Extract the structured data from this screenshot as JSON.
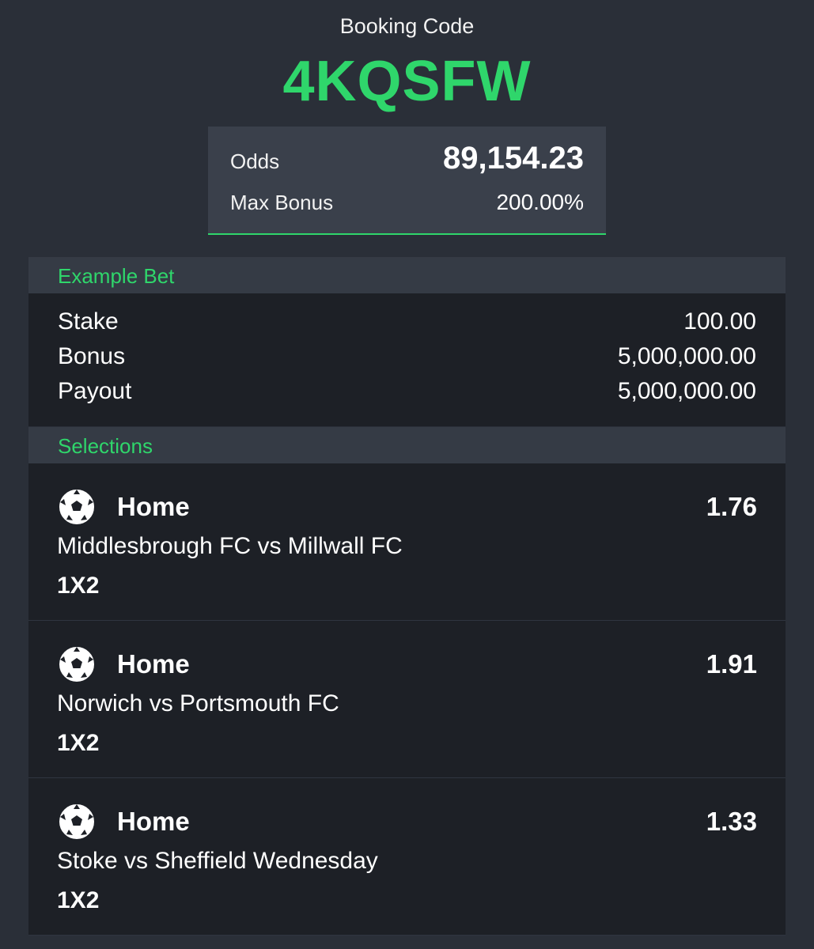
{
  "booking": {
    "label": "Booking Code",
    "code": "4KQSFW"
  },
  "summary": {
    "odds_label": "Odds",
    "odds_value": "89,154.23",
    "bonus_label": "Max Bonus",
    "bonus_value": "200.00%"
  },
  "example_bet": {
    "header": "Example Bet",
    "rows": [
      {
        "label": "Stake",
        "value": "100.00"
      },
      {
        "label": "Bonus",
        "value": "5,000,000.00"
      },
      {
        "label": "Payout",
        "value": "5,000,000.00"
      }
    ]
  },
  "selections": {
    "header": "Selections",
    "items": [
      {
        "pick": "Home",
        "odds": "1.76",
        "match": "Middlesbrough FC vs Millwall FC",
        "market": "1X2",
        "icon": "soccer-ball-icon"
      },
      {
        "pick": "Home",
        "odds": "1.91",
        "match": "Norwich vs Portsmouth FC",
        "market": "1X2",
        "icon": "soccer-ball-icon"
      },
      {
        "pick": "Home",
        "odds": "1.33",
        "match": "Stoke vs Sheffield Wednesday",
        "market": "1X2",
        "icon": "soccer-ball-icon"
      }
    ]
  },
  "colors": {
    "accent": "#2fd66b",
    "background": "#2a2f38",
    "card": "#3a404b",
    "row_background": "#1d2026"
  }
}
